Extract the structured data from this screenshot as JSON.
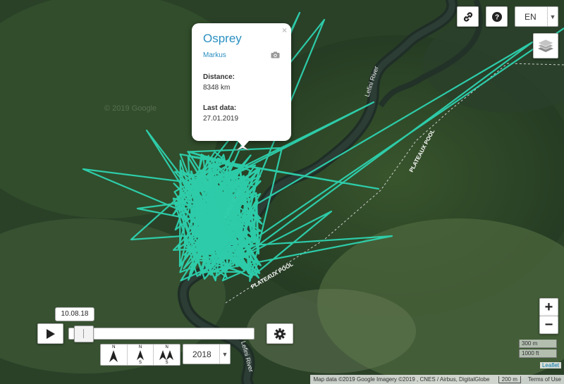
{
  "map": {
    "track_color": "#2ed3b0",
    "labels": [
      "Lefini River",
      "PLATEAUX POOL",
      "PLATEAUX POOL",
      "Lefini River",
      "Lefini River"
    ],
    "watermarks": [
      "© 2019 Google"
    ]
  },
  "popup": {
    "species": "Osprey",
    "name": "Markus",
    "distance_label": "Distance:",
    "distance_value": "8348 km",
    "last_label": "Last data:",
    "last_value": "27.01.2019",
    "close": "×"
  },
  "controls": {
    "language": "EN",
    "zoom_in": "+",
    "zoom_out": "−",
    "scale_metric": "300 m",
    "scale_imperial": "1000 ft",
    "leaflet": "Leaflet",
    "icons": [
      "link-icon",
      "help-icon",
      "layers-icon",
      "play-icon",
      "gear-icon",
      "camera-icon"
    ]
  },
  "timeline": {
    "date": "10.08.18",
    "year": "2018",
    "slider_position": 0.03,
    "compass": [
      {
        "top": "N",
        "bottom": ""
      },
      {
        "top": "N",
        "bottom": "S"
      },
      {
        "top": "N",
        "bottom": "S"
      }
    ]
  },
  "attribution": {
    "text": "Map data ©2019 Google Imagery ©2019 , CNES / Airbus, DigitalGlobe",
    "scale": "200 m",
    "terms": "Terms of Use"
  }
}
